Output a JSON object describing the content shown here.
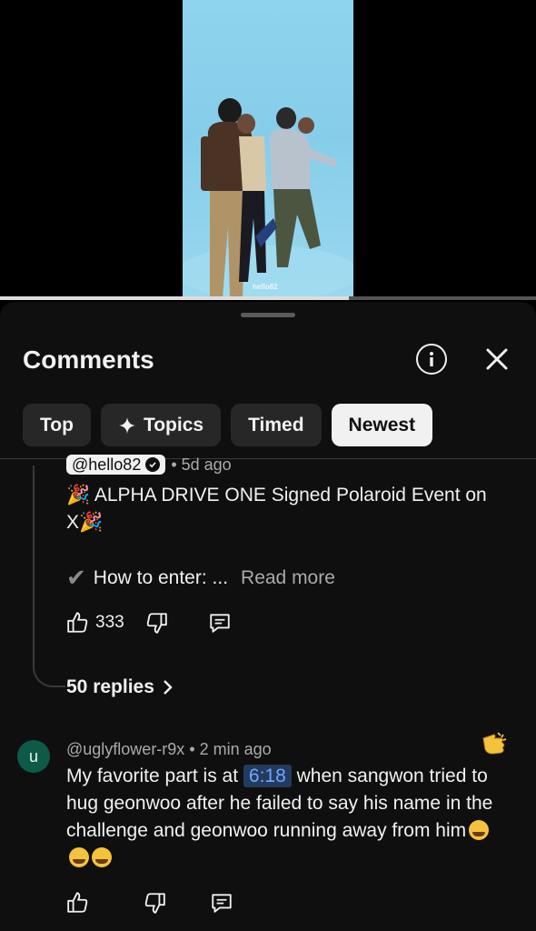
{
  "video": {
    "watermark": "hello82",
    "progress_fraction": 0.65
  },
  "sheet": {
    "title": "Comments",
    "info_icon": "info-icon",
    "close_icon": "close-icon"
  },
  "filters": {
    "top": "Top",
    "topics": "Topics",
    "timed": "Timed",
    "newest": "Newest",
    "active": "Newest"
  },
  "comment1": {
    "author": "@hello82",
    "time": "• 5d ago",
    "text": "🎉 ALPHA DRIVE ONE Signed Polaroid Event on X🎉",
    "enter_text": "How to enter: ...",
    "read_more": "Read more",
    "likes": "333",
    "replies": "50 replies"
  },
  "comment2": {
    "avatar_letter": "u",
    "author": "@uglyflower-r9x",
    "time": "• 2 min ago",
    "text_before": "My favorite part is at",
    "timestamp": "6:18",
    "text_after": "when sangwon tried to hug geonwoo after he failed to say his name in the challenge and geonwoo running away from him"
  },
  "colors": {
    "background": "#0f0f0f",
    "chip": "#272727",
    "chip_active": "#f1f1f1",
    "timestamp_link": "#6ea8ff",
    "avatar": "#0d5a48"
  }
}
